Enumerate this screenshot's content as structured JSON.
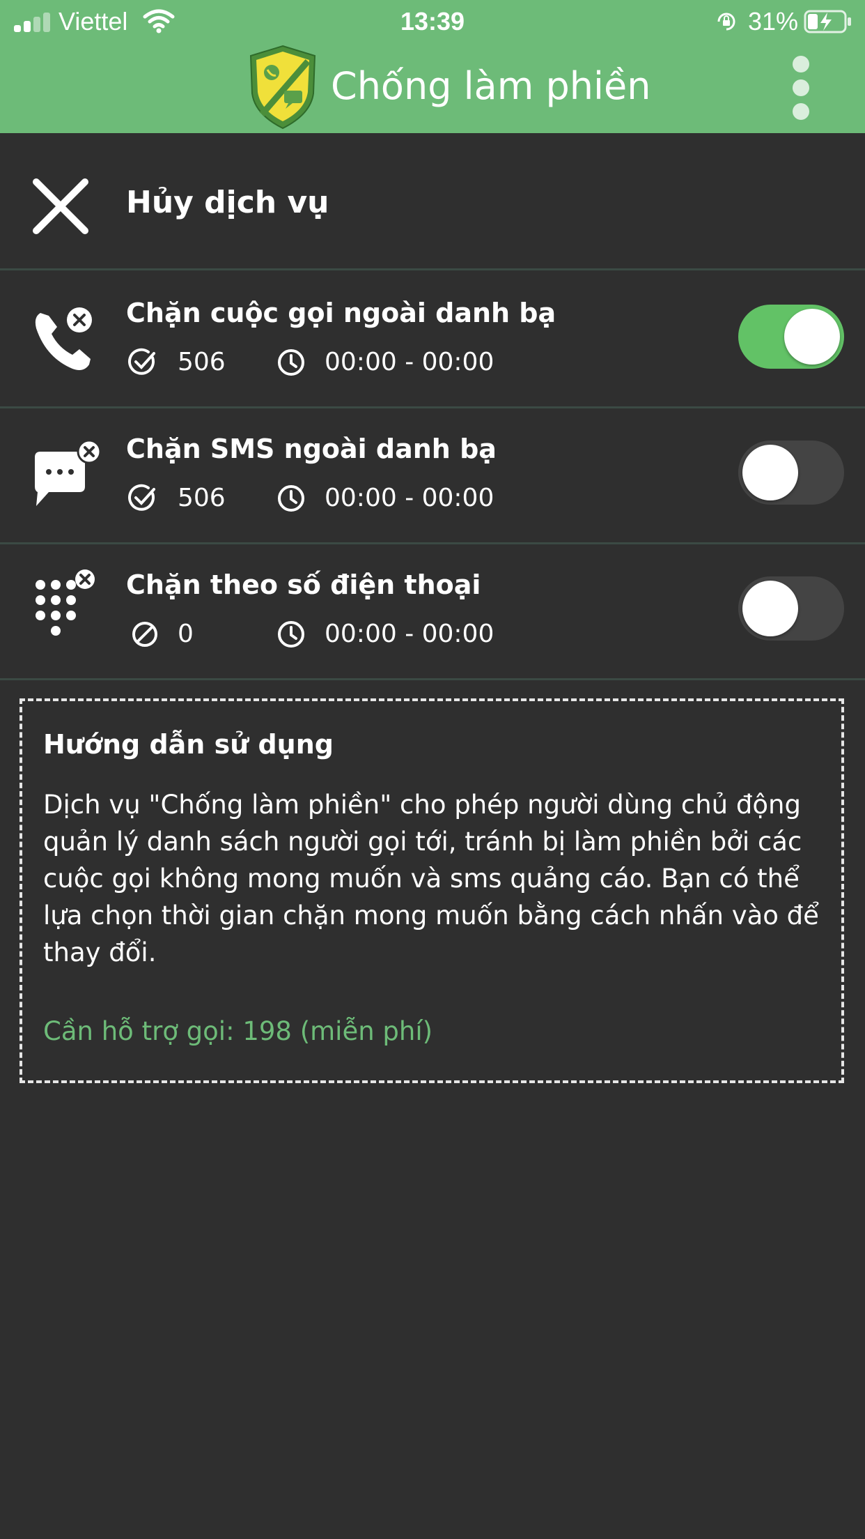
{
  "status_bar": {
    "carrier": "Viettel",
    "time": "13:39",
    "battery": "31%"
  },
  "header": {
    "title": "Chống làm phiền"
  },
  "cancel": {
    "label": "Hủy dịch vụ"
  },
  "services": [
    {
      "title": "Chặn cuộc gọi ngoài danh bạ",
      "count": "506",
      "time_range": "00:00 - 00:00",
      "enabled": true,
      "icon": "phone-block-icon",
      "count_icon": "check-circle-icon"
    },
    {
      "title": "Chặn SMS ngoài danh bạ",
      "count": "506",
      "time_range": "00:00 - 00:00",
      "enabled": false,
      "icon": "sms-block-icon",
      "count_icon": "check-circle-icon"
    },
    {
      "title": "Chặn theo số điện thoại",
      "count": "0",
      "time_range": "00:00 - 00:00",
      "enabled": false,
      "icon": "dialpad-block-icon",
      "count_icon": "block-circle-icon"
    }
  ],
  "guide": {
    "title": "Hướng dẫn sử dụng",
    "body": "Dịch vụ \"Chống làm phiền\" cho phép người dùng chủ động quản lý danh sách người gọi tới, tránh bị làm phiền bởi các cuộc gọi không mong muốn và sms quảng cáo. Bạn có thể lựa chọn thời gian chặn mong muốn bằng cách nhấn vào để thay đổi.",
    "support": "Cần hỗ trợ gọi: 198 (miễn phí)"
  },
  "colors": {
    "header_green": "#6dbb78",
    "toggle_on": "#62c266",
    "background": "#2f2f2f"
  }
}
